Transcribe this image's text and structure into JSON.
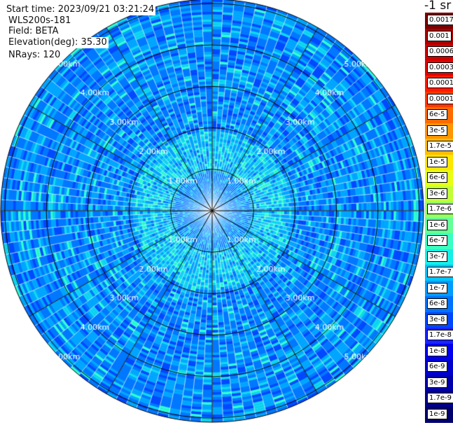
{
  "info": {
    "start_time": "Start time: 2023/09/21 03:21:24",
    "device": "WLS200s-181",
    "field": "Field: BETA",
    "elevation": "Elevation(deg): 35.30",
    "nrays": "NRays: 120"
  },
  "colorbar": {
    "unit": "-1 sr",
    "colors": [
      "#7a0000",
      "#a80000",
      "#cc0000",
      "#e60000",
      "#ff1a00",
      "#ff3a00",
      "#ff6a00",
      "#ff9500",
      "#ffbe00",
      "#ffe600",
      "#e6ff12",
      "#c0ff38",
      "#96ff62",
      "#64ff96",
      "#3affc0",
      "#14f0e8",
      "#00c6ff",
      "#009cff",
      "#0072ff",
      "#0046ff",
      "#1a22ff",
      "#0000ee",
      "#0000cc",
      "#0000aa",
      "#000088",
      "#00006a"
    ],
    "labels": [
      "0.0017",
      "0.001",
      "0.0006",
      "0.0003",
      "0.00017",
      "0.0001",
      "6e-5",
      "3e-5",
      "1.7e-5",
      "1e-5",
      "6e-6",
      "3e-6",
      "1.7e-6",
      "1e-6",
      "6e-7",
      "3e-7",
      "1.7e-7",
      "1e-7",
      "6e-8",
      "3e-8",
      "1.7e-8",
      "1e-8",
      "6e-9",
      "3e-9",
      "1.7e-9",
      "1e-9"
    ]
  },
  "chart_data": {
    "type": "heatmap",
    "projection": "polar-ppi",
    "nrays": 120,
    "ring_labels": [
      "1.00km",
      "2.00km",
      "3.00km",
      "4.00km",
      "5.00km"
    ],
    "ring_km": [
      1,
      2,
      3,
      4,
      5
    ],
    "max_range_km": 5.1,
    "azimuth_grid_deg": [
      0,
      30,
      60,
      90,
      120,
      150,
      180,
      210,
      240,
      270,
      300,
      330
    ],
    "range_zones": [
      {
        "from_km": 0.0,
        "to_km": 0.9,
        "typical": "6e-8"
      },
      {
        "from_km": 0.9,
        "to_km": 2.0,
        "typical": "1.7e-7"
      },
      {
        "from_km": 2.0,
        "to_km": 5.1,
        "typical": "6e-8"
      }
    ],
    "colormap": "jet",
    "scale": "log"
  }
}
